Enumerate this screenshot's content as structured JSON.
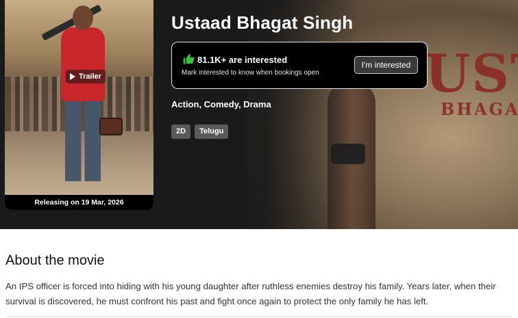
{
  "movie": {
    "title": "Ustaad Bhagat Singh",
    "release": "Releasing on 19 Mar, 2026",
    "trailer_label": "Trailer",
    "genres": "Action, Comedy, Drama",
    "formats": [
      "2D",
      "Telugu"
    ]
  },
  "interest": {
    "count_text": "81.1K+ are interested",
    "hint": "Mark interested to know when bookings open",
    "button_label": "I'm interested"
  },
  "backdrop": {
    "title_text": "UST",
    "sub_text": "BHAGA"
  },
  "about": {
    "heading": "About the movie",
    "description": "An IPS officer is forced into hiding with his young daughter after ruthless enemies destroy his family. Years later, when their survival is discovered, he must confront his past and fight once again to protect the only family he has left."
  },
  "icons": {
    "thumb": "thumbs-up-icon",
    "play": "play-icon"
  },
  "colors": {
    "thumb_green": "#3cbf3c",
    "hero_bg": "#1a1a1a",
    "tag_bg": "#5a5a5a"
  }
}
